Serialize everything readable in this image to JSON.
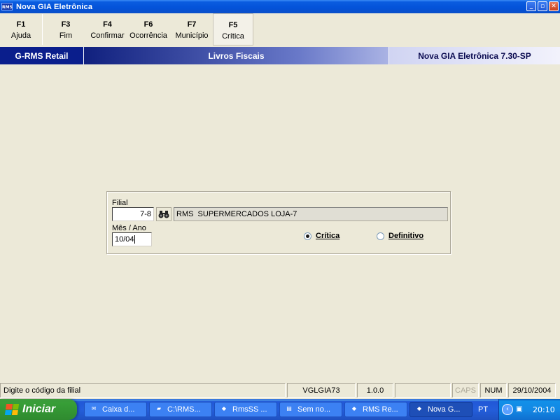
{
  "window": {
    "title": "Nova GIA Eletrônica",
    "icon_text": "RMS",
    "controls": [
      "minimize",
      "maximize",
      "close"
    ]
  },
  "toolbar": {
    "buttons": [
      {
        "key": "F1",
        "label": "Ajuda"
      },
      {
        "key": "F3",
        "label": "Fim"
      },
      {
        "key": "F4",
        "label": "Confirmar"
      },
      {
        "key": "F6",
        "label": "Ocorrência"
      },
      {
        "key": "F7",
        "label": "Município"
      },
      {
        "key": "F5",
        "label": "Crítica"
      }
    ]
  },
  "header": {
    "left": "G-RMS Retail",
    "center": "Livros Fiscais",
    "right": "Nova GIA Eletrônica 7.30-SP"
  },
  "form": {
    "filial_label": "Filial",
    "filial_value": "7-8",
    "filial_name": "RMS  SUPERMERCADOS LOJA-7",
    "mes_ano_label": "Mês / Ano",
    "mes_ano_value": "10/04",
    "options": [
      {
        "label": "Crítica",
        "selected": true
      },
      {
        "label": "Definitivo",
        "selected": false
      }
    ]
  },
  "statusbar": {
    "message": "Digite o código da filial",
    "program": "VGLGIA73",
    "version": "1.0.0",
    "caps": "CAPS",
    "num": "NUM",
    "date": "29/10/2004"
  },
  "taskbar": {
    "start_label": "Iniciar",
    "tasks": [
      {
        "label": "Caixa d...",
        "icon": "inbox-icon"
      },
      {
        "label": "C:\\RMS...",
        "icon": "folder-icon"
      },
      {
        "label": "RmsSS ...",
        "icon": "rms-app-icon"
      },
      {
        "label": "Sem no...",
        "icon": "notepad-icon"
      },
      {
        "label": "RMS Re...",
        "icon": "rms-app-icon"
      },
      {
        "label": "Nova G...",
        "icon": "rms-app-icon"
      }
    ],
    "language": "PT",
    "clock": "20:10"
  }
}
